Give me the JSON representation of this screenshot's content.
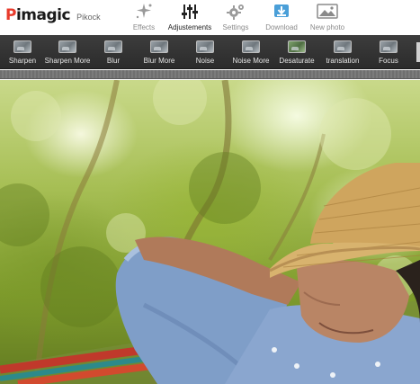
{
  "app": {
    "logo_main": "Pimagic",
    "logo_sub": "Pikock"
  },
  "nav": {
    "items": [
      {
        "label": "Effects",
        "icon": "sparkle-icon"
      },
      {
        "label": "Adjustements",
        "icon": "sliders-icon",
        "active": true
      },
      {
        "label": "Settings",
        "icon": "gear-icon"
      },
      {
        "label": "Download",
        "icon": "download-icon"
      },
      {
        "label": "New photo",
        "icon": "photo-icon"
      }
    ]
  },
  "filters": {
    "items": [
      {
        "label": "Sharpen"
      },
      {
        "label": "Sharpen More"
      },
      {
        "label": "Blur"
      },
      {
        "label": "Blur More"
      },
      {
        "label": "Noise"
      },
      {
        "label": "Noise More"
      },
      {
        "label": "Desaturate"
      },
      {
        "label": "translation"
      },
      {
        "label": "Focus"
      }
    ]
  },
  "colors": {
    "brand_accent": "#e83a2b",
    "toolbar_bg": "#333333",
    "download_blue": "#4a9fd8"
  }
}
